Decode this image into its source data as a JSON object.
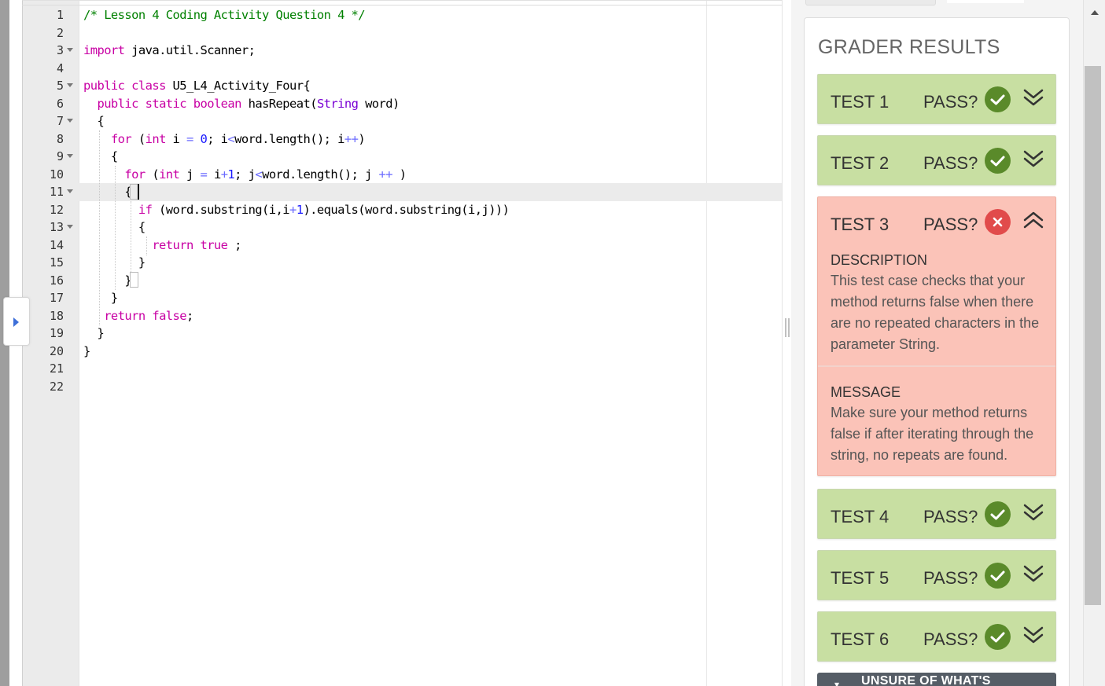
{
  "editor": {
    "active_line": 11,
    "lines": [
      {
        "n": "1",
        "fold": false,
        "code": "/* Lesson 4 Coding Activity Question 4 */"
      },
      {
        "n": "2",
        "fold": false,
        "code": ""
      },
      {
        "n": "3",
        "fold": true,
        "code": "import java.util.Scanner;"
      },
      {
        "n": "4",
        "fold": false,
        "code": ""
      },
      {
        "n": "5",
        "fold": true,
        "code": "public class U5_L4_Activity_Four{"
      },
      {
        "n": "6",
        "fold": false,
        "code": "  public static boolean hasRepeat(String word)"
      },
      {
        "n": "7",
        "fold": true,
        "code": "  {"
      },
      {
        "n": "8",
        "fold": false,
        "code": "    for (int i = 0; i<word.length(); i++)"
      },
      {
        "n": "9",
        "fold": true,
        "code": "    {"
      },
      {
        "n": "10",
        "fold": false,
        "code": "      for (int j = i+1; j<word.length(); j ++ )"
      },
      {
        "n": "11",
        "fold": true,
        "code": "      {"
      },
      {
        "n": "12",
        "fold": false,
        "code": "        if (word.substring(i,i+1).equals(word.substring(i,j)))"
      },
      {
        "n": "13",
        "fold": true,
        "code": "        {"
      },
      {
        "n": "14",
        "fold": false,
        "code": "          return true ;"
      },
      {
        "n": "15",
        "fold": false,
        "code": "        }"
      },
      {
        "n": "16",
        "fold": false,
        "code": "      }"
      },
      {
        "n": "17",
        "fold": false,
        "code": "    }"
      },
      {
        "n": "18",
        "fold": false,
        "code": "   return false;"
      },
      {
        "n": "19",
        "fold": false,
        "code": "  }"
      },
      {
        "n": "20",
        "fold": false,
        "code": "}"
      },
      {
        "n": "21",
        "fold": false,
        "code": ""
      },
      {
        "n": "22",
        "fold": false,
        "code": ""
      }
    ]
  },
  "grader": {
    "title": "GRADER RESULTS",
    "pass_label": "PASS?",
    "tests": [
      {
        "name": "TEST 1",
        "passed": true,
        "expanded": false
      },
      {
        "name": "TEST 2",
        "passed": true,
        "expanded": false
      },
      {
        "name": "TEST 3",
        "passed": false,
        "expanded": true,
        "description_label": "DESCRIPTION",
        "description": "This test case checks that your method returns false when there are no repeated characters in the parameter String.",
        "message_label": "MESSAGE",
        "message": "Make sure your method returns false if after iterating through the string, no repeats are found."
      },
      {
        "name": "TEST 4",
        "passed": true,
        "expanded": false
      },
      {
        "name": "TEST 5",
        "passed": true,
        "expanded": false
      },
      {
        "name": "TEST 6",
        "passed": true,
        "expanded": false
      }
    ],
    "help_button": "UNSURE OF WHAT'S"
  },
  "colors": {
    "pass_bg": "#c8dfa2",
    "fail_bg": "#fbc3b8",
    "pass_icon": "#5a8a2a",
    "fail_icon": "#e14b4b",
    "comment": "#008000",
    "keyword": "#c800a4",
    "type": "#7a00d4"
  },
  "icons": {
    "pass": "check-circle-icon",
    "fail": "x-circle-icon",
    "collapsed": "double-chevron-down-icon",
    "expanded": "double-chevron-up-icon",
    "panel_toggle": "caret-right-icon"
  }
}
